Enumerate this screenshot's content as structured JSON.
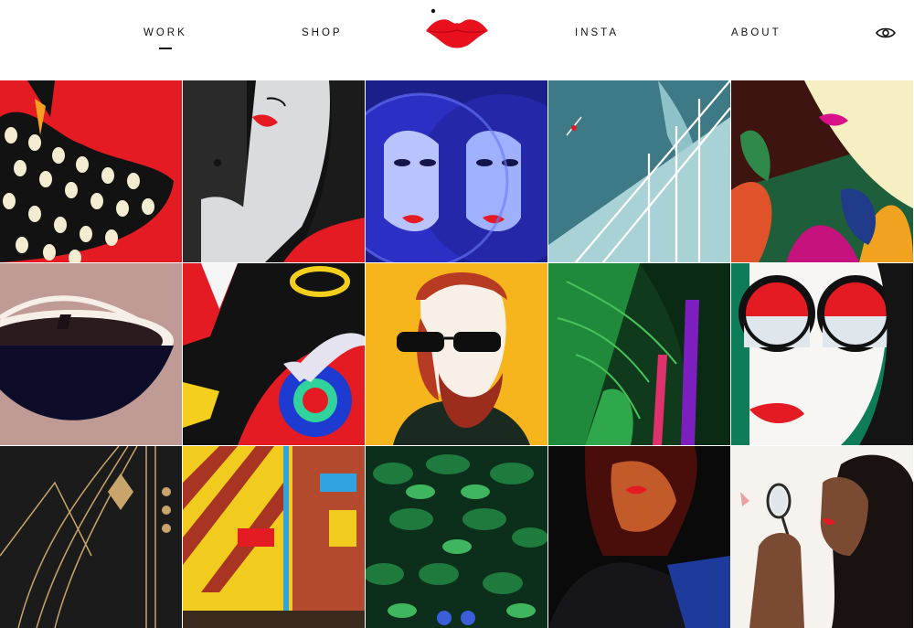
{
  "nav": {
    "work_label": "WORK",
    "shop_label": "SHOP",
    "insta_label": "INSTA",
    "about_label": "ABOUT",
    "active": "work"
  },
  "icons": {
    "logo": "lips-logo",
    "view_toggle": "eye-icon"
  },
  "colors": {
    "brand_red": "#e8101c",
    "text": "#111111",
    "background": "#ffffff"
  },
  "gallery": {
    "columns": 5,
    "visible_rows": 3,
    "artworks": [
      "polka-dot-hat",
      "woman-with-red-lips-hand",
      "astronauts-blue",
      "bridge-pole-vault",
      "jungle-woman-portrait",
      "coffee-cup",
      "woman-arm-red-dress",
      "bearded-man-sunglasses",
      "tropical-palm-leaves",
      "woman-round-sunglasses",
      "art-deco-gold",
      "striped-architecture",
      "face-in-foliage",
      "woman-red-lips-dark",
      "woman-with-mirror"
    ]
  }
}
